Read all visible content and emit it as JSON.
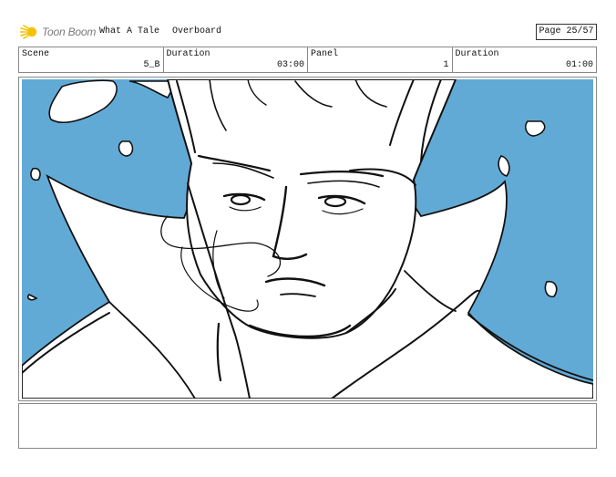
{
  "header": {
    "logo_text": "Toon Boom",
    "project_title": "What A Tale",
    "episode_title": "Overboard",
    "page_label": "Page 25/57"
  },
  "info": {
    "scene_label": "Scene",
    "scene_value": "5_B",
    "scene_duration_label": "Duration",
    "scene_duration_value": "03:00",
    "panel_label": "Panel",
    "panel_value": "1",
    "panel_duration_label": "Duration",
    "panel_duration_value": "01:00"
  },
  "colors": {
    "sky": "#62aad6",
    "ink": "#111111",
    "logo_yellow": "#f2c200"
  },
  "notes": {
    "text": ""
  }
}
